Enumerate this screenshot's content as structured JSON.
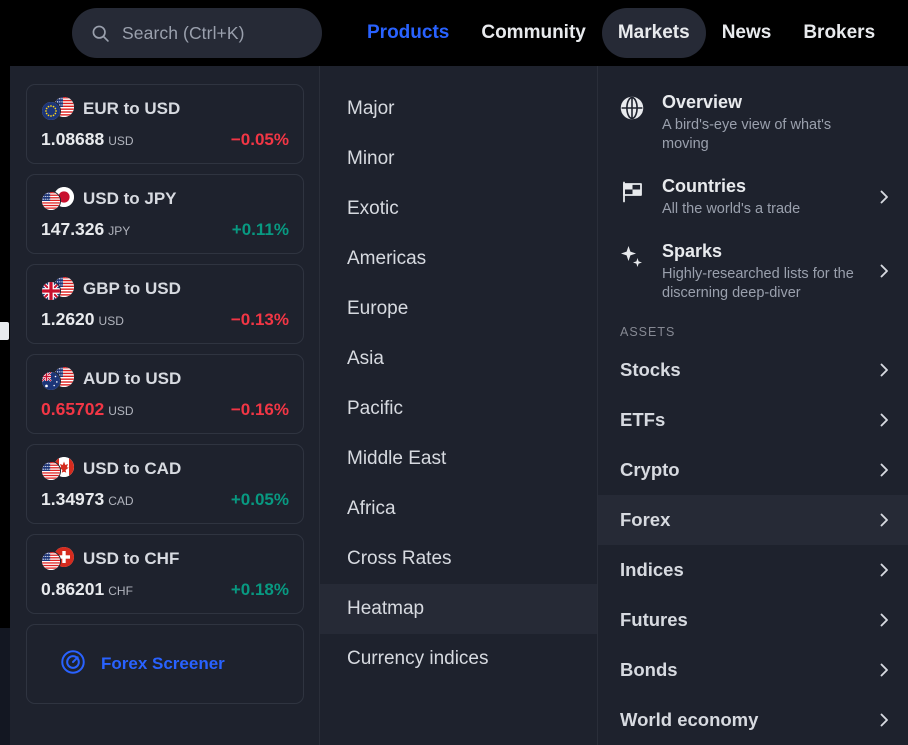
{
  "topbar": {
    "search": {
      "placeholder": "Search (Ctrl+K)",
      "icon": "search-icon"
    },
    "nav": [
      {
        "label": "Products",
        "style": "accent",
        "active": false
      },
      {
        "label": "Community",
        "style": "plain",
        "active": false
      },
      {
        "label": "Markets",
        "style": "plain",
        "active": true
      },
      {
        "label": "News",
        "style": "plain",
        "active": false
      },
      {
        "label": "Brokers",
        "style": "plain",
        "active": false
      }
    ]
  },
  "watchlist": {
    "quotes": [
      {
        "name": "EUR to USD",
        "price": "1.08688",
        "currency": "USD",
        "change": "−0.05%",
        "dir": "down",
        "price_down": false,
        "base": "eu",
        "quote": "us"
      },
      {
        "name": "USD to JPY",
        "price": "147.326",
        "currency": "JPY",
        "change": "+0.11%",
        "dir": "up",
        "price_down": false,
        "base": "us",
        "quote": "jp"
      },
      {
        "name": "GBP to USD",
        "price": "1.2620",
        "currency": "USD",
        "change": "−0.13%",
        "dir": "down",
        "price_down": false,
        "base": "gb",
        "quote": "us"
      },
      {
        "name": "AUD to USD",
        "price": "0.65702",
        "currency": "USD",
        "change": "−0.16%",
        "dir": "down",
        "price_down": true,
        "base": "au",
        "quote": "us"
      },
      {
        "name": "USD to CAD",
        "price": "1.34973",
        "currency": "CAD",
        "change": "+0.05%",
        "dir": "up",
        "price_down": false,
        "base": "us",
        "quote": "ca"
      },
      {
        "name": "USD to CHF",
        "price": "0.86201",
        "currency": "CHF",
        "change": "+0.18%",
        "dir": "up",
        "price_down": false,
        "base": "us",
        "quote": "ch"
      }
    ],
    "screener": {
      "label": "Forex Screener",
      "icon": "target-icon"
    }
  },
  "categories": [
    {
      "label": "Major",
      "active": false
    },
    {
      "label": "Minor",
      "active": false
    },
    {
      "label": "Exotic",
      "active": false
    },
    {
      "label": "Americas",
      "active": false
    },
    {
      "label": "Europe",
      "active": false
    },
    {
      "label": "Asia",
      "active": false
    },
    {
      "label": "Pacific",
      "active": false
    },
    {
      "label": "Middle East",
      "active": false
    },
    {
      "label": "Africa",
      "active": false
    },
    {
      "label": "Cross Rates",
      "active": false
    },
    {
      "label": "Heatmap",
      "active": true
    },
    {
      "label": "Currency indices",
      "active": false
    }
  ],
  "assets_column": {
    "features": [
      {
        "title": "Overview",
        "subtitle": "A bird's-eye view of what's moving",
        "icon": "globe-icon",
        "chevron": false
      },
      {
        "title": "Countries",
        "subtitle": "All the world's a trade",
        "icon": "flag-icon",
        "chevron": true
      },
      {
        "title": "Sparks",
        "subtitle": "Highly-researched lists for the discerning deep-diver",
        "icon": "sparkle-icon",
        "chevron": true
      }
    ],
    "section_label": "ASSETS",
    "items": [
      {
        "label": "Stocks",
        "active": false,
        "chevron": true
      },
      {
        "label": "ETFs",
        "active": false,
        "chevron": true
      },
      {
        "label": "Crypto",
        "active": false,
        "chevron": true
      },
      {
        "label": "Forex",
        "active": true,
        "chevron": true
      },
      {
        "label": "Indices",
        "active": false,
        "chevron": true
      },
      {
        "label": "Futures",
        "active": false,
        "chevron": true
      },
      {
        "label": "Bonds",
        "active": false,
        "chevron": true
      },
      {
        "label": "World economy",
        "active": false,
        "chevron": true
      }
    ]
  },
  "colors": {
    "accent": "#2962ff",
    "up": "#089981",
    "down": "#f23645",
    "panel_bg": "#1e222d",
    "highlight_bg": "#262a36",
    "topbar_bg": "#000000"
  }
}
